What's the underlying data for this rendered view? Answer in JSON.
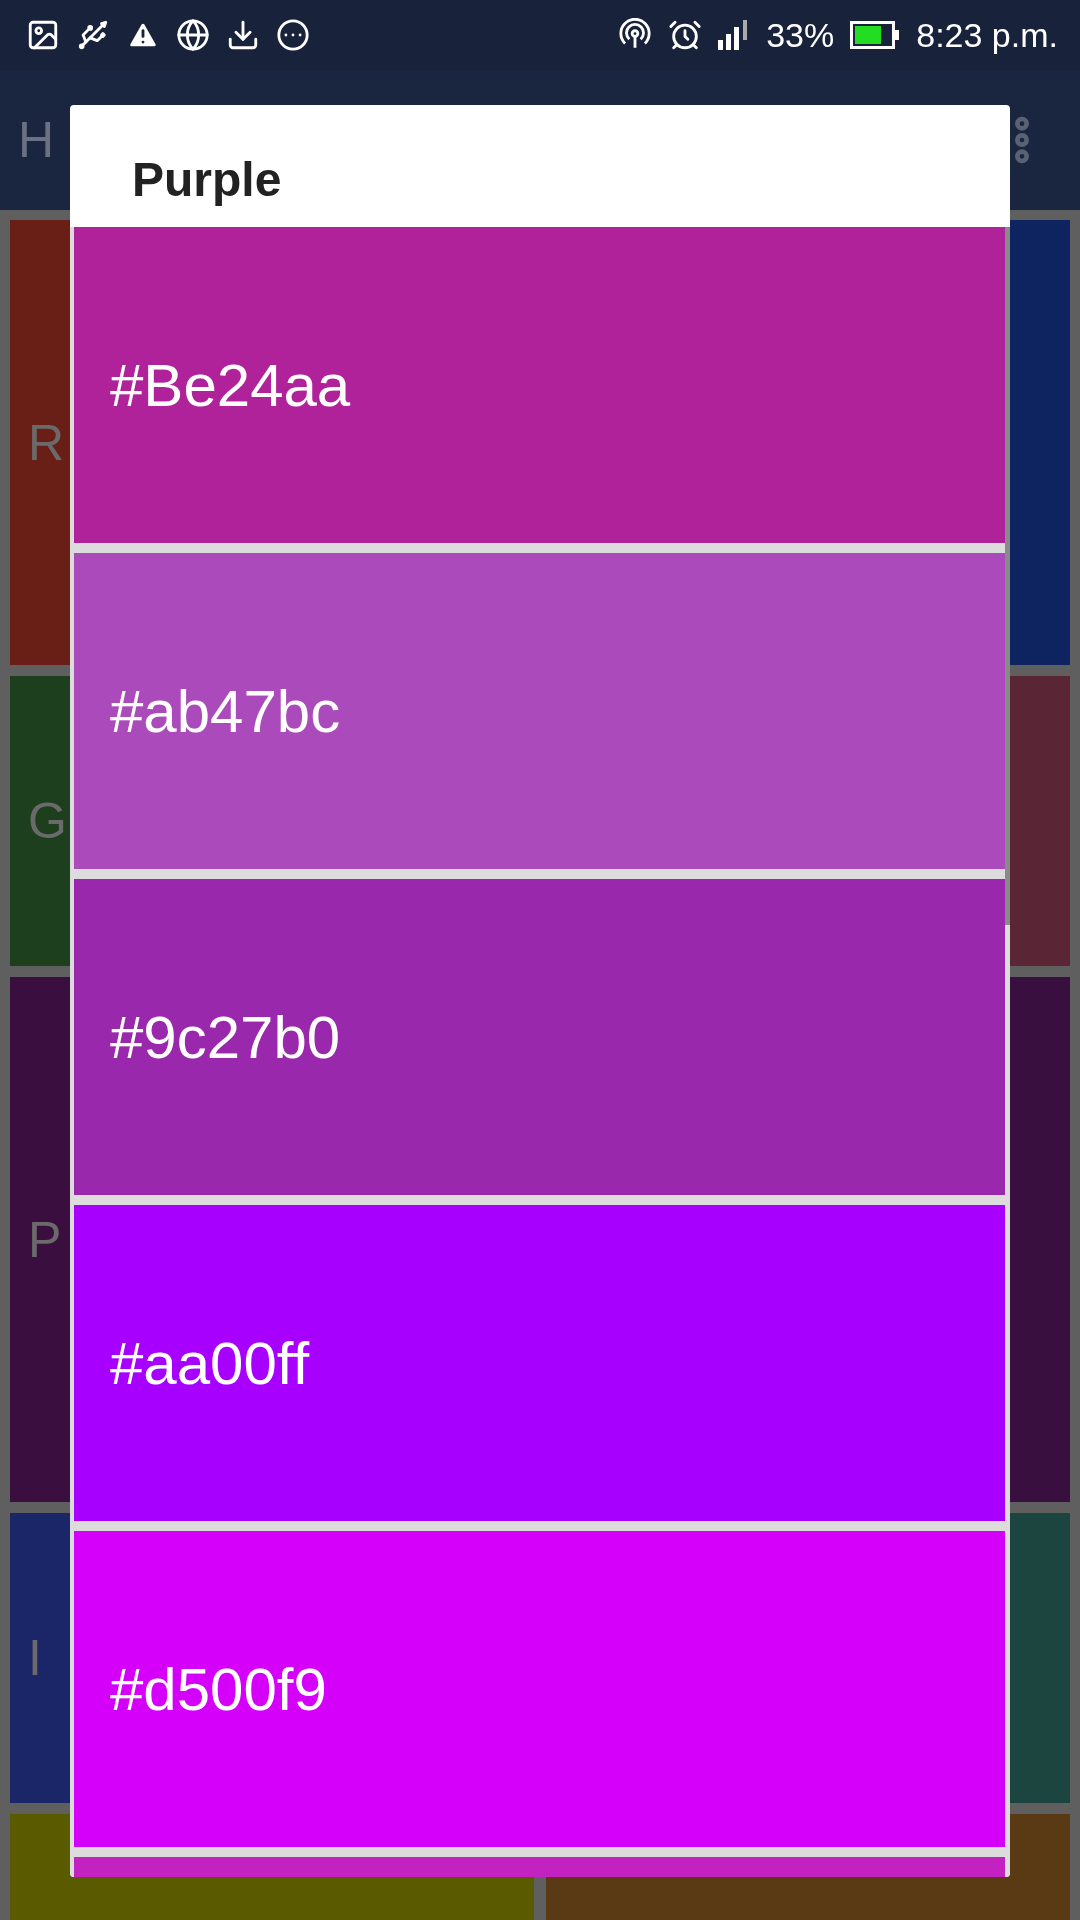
{
  "status_bar": {
    "battery_percent": "33%",
    "time": "8:23 p.m."
  },
  "app_bar": {
    "title": "H"
  },
  "tiles": [
    [
      {
        "label": "R",
        "color": "#6a1f16"
      },
      {
        "label": "G",
        "color": "#1d3f1e"
      },
      {
        "label": "P",
        "color": "#3a0f3f"
      },
      {
        "label": "I",
        "color": "#1b2668"
      },
      {
        "color": "#5a5a00"
      }
    ],
    [
      {
        "color": "#0e2460"
      },
      {
        "color": "#5a2535"
      },
      {
        "color": "#390f40"
      },
      {
        "color": "#1d4540"
      },
      {
        "color": "#5a3a15"
      }
    ]
  ],
  "dialog": {
    "title": "Purple",
    "swatches": [
      {
        "hex": "#Be24aa",
        "color": "#b0229a"
      },
      {
        "hex": "#ab47bc",
        "color": "#ab4bbb"
      },
      {
        "hex": "#9c27b0",
        "color": "#9a28ac"
      },
      {
        "hex": "#aa00ff",
        "color": "#a800ff"
      },
      {
        "hex": "#d500f9",
        "color": "#d500f9"
      },
      {
        "color": "#c322c0"
      }
    ]
  }
}
